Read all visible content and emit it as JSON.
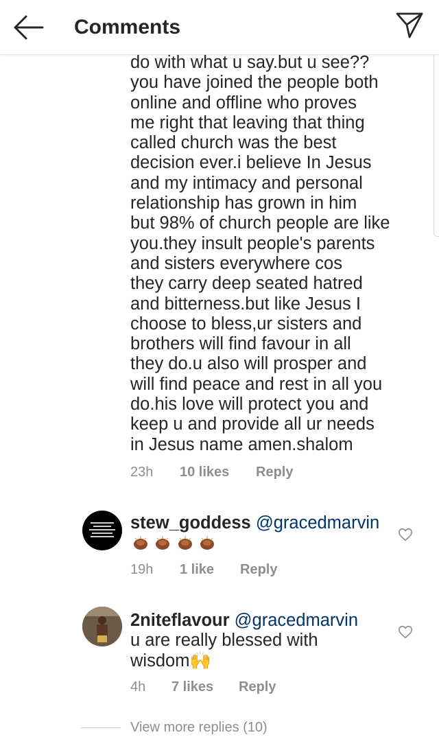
{
  "header": {
    "title": "Comments",
    "back_icon": "arrow-left-icon",
    "send_icon": "paper-plane-icon"
  },
  "comments": [
    {
      "text_lines": [
        "do with what u say.but u see??",
        "you have joined the people both",
        "online and offline who proves",
        "me right that leaving that thing",
        "called church was the best",
        "decision ever.i believe In Jesus",
        "and my intimacy and personal",
        "relationship has grown in him",
        "but 98% of church people are like",
        "you.they insult people's parents",
        "and sisters everywhere cos",
        "they carry deep seated hatred",
        "and bitterness.but like Jesus I",
        "choose to bless,ur sisters and",
        "brothers will find favour in all",
        "they do.u also will prosper and",
        "will find peace and rest in all you",
        "do.his love will protect you and",
        "keep u and provide all ur needs",
        "in Jesus name amen.shalom"
      ],
      "time": "23h",
      "likes": "10 likes",
      "reply": "Reply"
    },
    {
      "username": "stew_goddess",
      "mention": "@gracedmarvin",
      "emoji": "praying-hands-x4",
      "time": "19h",
      "likes": "1 like",
      "reply": "Reply"
    },
    {
      "username": "2niteflavour",
      "mention": "@gracedmarvin",
      "text_line1": "u are really blessed with",
      "text_line2": "wisdom🙌",
      "time": "4h",
      "likes": "7 likes",
      "reply": "Reply"
    }
  ],
  "view_more": "View more replies (10)",
  "colors": {
    "text": "#262626",
    "meta": "#8e8e8e",
    "mention": "#003569",
    "divider": "#c7c7c7"
  }
}
